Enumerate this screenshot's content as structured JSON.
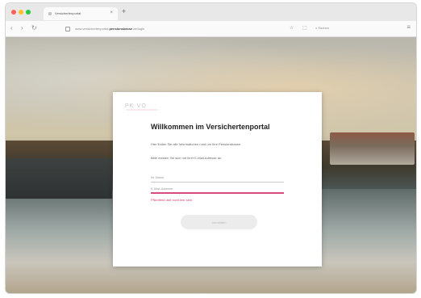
{
  "browser": {
    "tab_title": "Versicherten­portal",
    "new_tab_label": "+",
    "url_prefix": "www.versichertenportal.",
    "url_host": "pensionskasse",
    "url_suffix": ".de/login",
    "search_label": "Suchen",
    "window_controls": [
      "close",
      "minimize",
      "maximize"
    ]
  },
  "logo": {
    "text": "PK·VO",
    "accent_color": "#d64c7e"
  },
  "login": {
    "heading": "Willkommen im Versichertenportal",
    "paragraph_1": "Hier finden Sie alle Informationen rund um Ihre Pensionskasse.",
    "paragraph_2": "Bitte melden Sie sich mit Ihrer E-Mail-Adresse an.",
    "name_placeholder": "Ihr Name",
    "email_placeholder": "E-Mail-Adresse",
    "error_message": "Pflichtfeld darf nicht leer sein",
    "submit_label": "Anmelden"
  },
  "colors": {
    "accent": "#d64c7e",
    "error": "#d23c6e",
    "button_disabled": "#ececec"
  }
}
